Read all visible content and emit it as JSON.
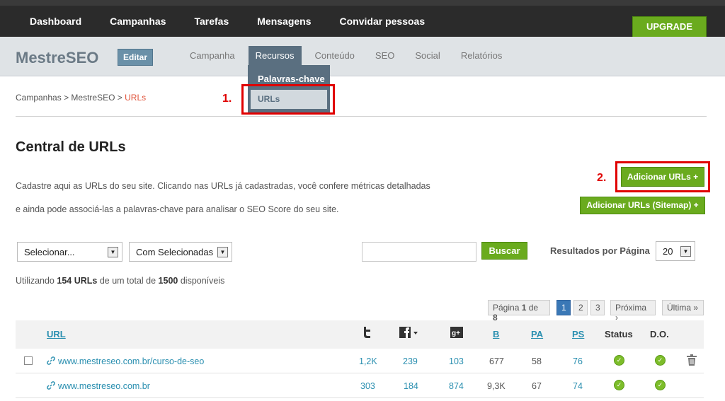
{
  "topnav": {
    "items": [
      "Dashboard",
      "Campanhas",
      "Tarefas",
      "Mensagens",
      "Convidar pessoas"
    ],
    "upgrade": "UPGRADE"
  },
  "project": {
    "name": "MestreSEO",
    "edit": "Editar"
  },
  "subnav": {
    "items": [
      "Campanha",
      "Recursos",
      "Conteúdo",
      "SEO",
      "Social",
      "Relatórios"
    ]
  },
  "dropdown": {
    "items": [
      "Palavras-chave",
      "URLs"
    ]
  },
  "annotations": {
    "step1": "1.",
    "step2": "2."
  },
  "breadcrumb": {
    "items": [
      "Campanhas",
      "MestreSEO",
      "URLs"
    ],
    "sep": ">"
  },
  "page": {
    "title": "Central de URLs",
    "desc_line1": "Cadastre aqui as URLs do seu site. Clicando nas URLs já cadastradas, você confere métricas detalhadas",
    "desc_line2": "e ainda pode associá-las a palavras-chave para analisar o SEO Score do seu site."
  },
  "buttons": {
    "add_urls": "Adicionar URLs +",
    "add_sitemap": "Adicionar URLs (Sitemap) +",
    "search": "Buscar"
  },
  "filters": {
    "select1": "Selecionar...",
    "select2": "Com Selecionadas",
    "search_value": "",
    "results_label": "Resultados por Página",
    "results_value": "20"
  },
  "usage": {
    "prefix": "Utilizando",
    "used": "154 URLs",
    "middle": "de um total de",
    "total": "1500",
    "suffix": "disponíveis"
  },
  "pagination": {
    "info_prefix": "Página",
    "current": "1",
    "info_mid": "de",
    "total": "8",
    "pages": [
      "1",
      "2",
      "3"
    ],
    "next": "Próxima ›",
    "last": "Última »"
  },
  "table": {
    "headers": {
      "url": "URL",
      "twitter_icon": "twitter-icon",
      "facebook_icon": "facebook-icon",
      "googleplus_icon": "google-plus-icon",
      "b": "B",
      "pa": "PA",
      "ps": "PS",
      "status": "Status",
      "do": "D.O."
    },
    "rows": [
      {
        "url": "www.mestreseo.com.br/curso-de-seo",
        "tw": "1,2K",
        "fb": "239",
        "gp": "103",
        "b": "677",
        "pa": "58",
        "ps": "76"
      },
      {
        "url": "www.mestreseo.com.br",
        "tw": "303",
        "fb": "184",
        "gp": "874",
        "b": "9,3K",
        "pa": "67",
        "ps": "74"
      }
    ]
  },
  "colors": {
    "accent_green": "#6aab1e",
    "link": "#2a8fb0",
    "annotation_red": "#e00000"
  }
}
